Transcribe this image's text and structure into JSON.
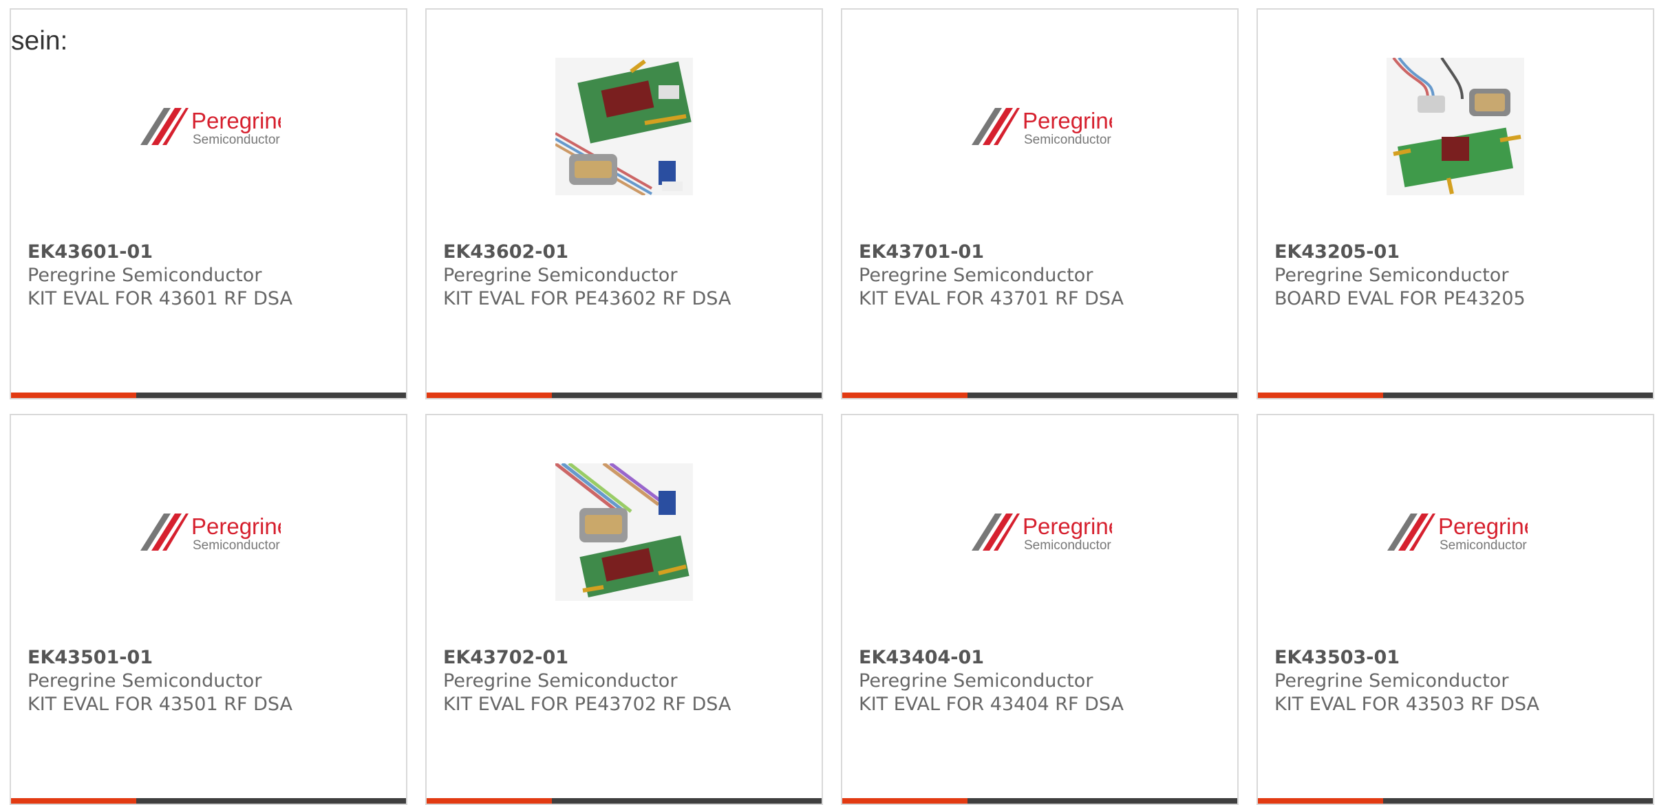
{
  "intro_text": "sein:",
  "colors": {
    "accent": "#e23a12",
    "bar": "#3f3f3f",
    "border": "#d9d9d9",
    "logo_red": "#d6202e"
  },
  "logo": {
    "line1": "Peregrine",
    "line2": "Semiconductor"
  },
  "products": [
    {
      "part": "EK43601-01",
      "maker": "Peregrine Semiconductor",
      "desc": "KIT EVAL FOR 43601 RF DSA",
      "image": "peregrine-logo"
    },
    {
      "part": "EK43602-01",
      "maker": "Peregrine Semiconductor",
      "desc": "KIT EVAL FOR PE43602 RF DSA",
      "image": "eval-board-photo"
    },
    {
      "part": "EK43701-01",
      "maker": "Peregrine Semiconductor",
      "desc": "KIT EVAL FOR 43701 RF DSA",
      "image": "peregrine-logo"
    },
    {
      "part": "EK43205-01",
      "maker": "Peregrine Semiconductor",
      "desc": "BOARD EVAL FOR PE43205",
      "image": "eval-board-photo"
    },
    {
      "part": "EK43501-01",
      "maker": "Peregrine Semiconductor",
      "desc": "KIT EVAL FOR 43501 RF DSA",
      "image": "peregrine-logo"
    },
    {
      "part": "EK43702-01",
      "maker": "Peregrine Semiconductor",
      "desc": "KIT EVAL FOR PE43702 RF DSA",
      "image": "eval-board-photo"
    },
    {
      "part": "EK43404-01",
      "maker": "Peregrine Semiconductor",
      "desc": "KIT EVAL FOR 43404 RF DSA",
      "image": "peregrine-logo"
    },
    {
      "part": "EK43503-01",
      "maker": "Peregrine Semiconductor",
      "desc": "KIT EVAL FOR 43503 RF DSA",
      "image": "peregrine-logo"
    }
  ]
}
